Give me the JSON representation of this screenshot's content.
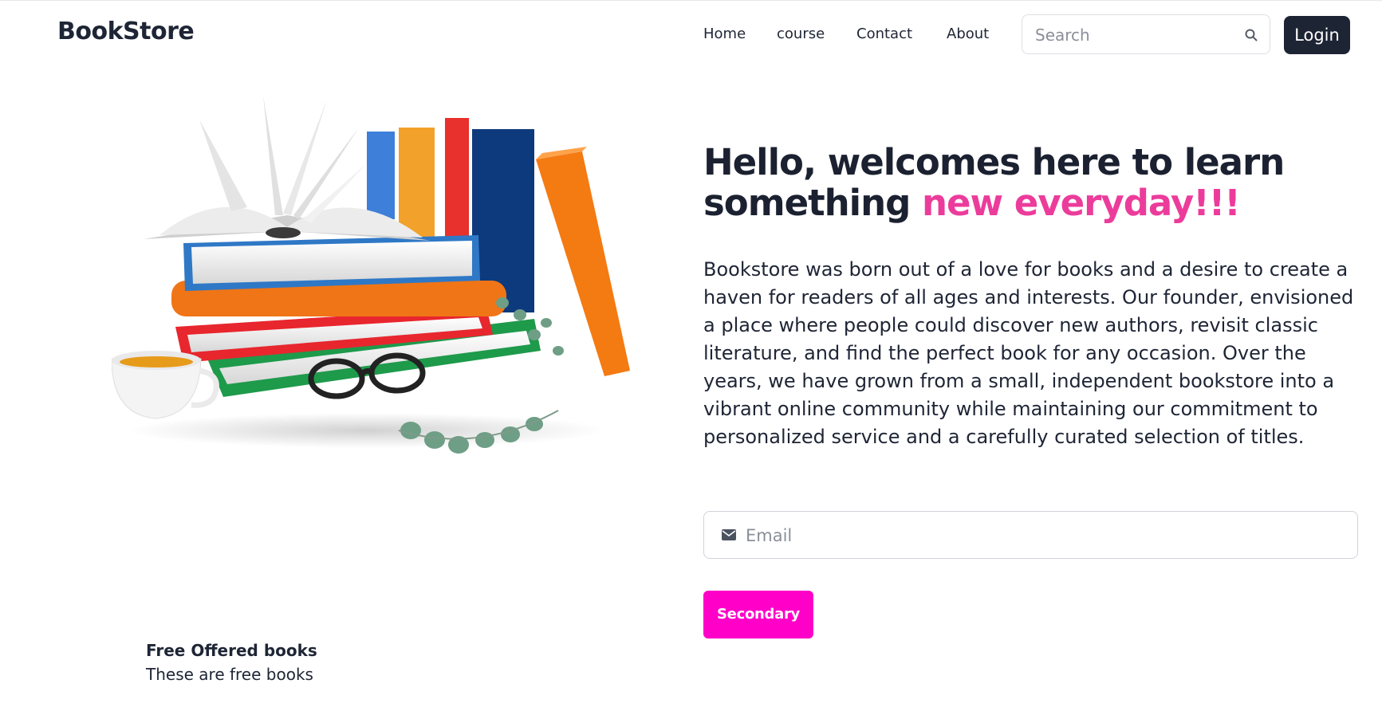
{
  "brand": {
    "name": "BookStore"
  },
  "nav": {
    "items": [
      {
        "label": "Home"
      },
      {
        "label": "course"
      },
      {
        "label": "Contact"
      },
      {
        "label": "About"
      }
    ]
  },
  "search": {
    "placeholder": "Search",
    "icon": "search-icon"
  },
  "login": {
    "label": "Login"
  },
  "hero": {
    "title_part1": "Hello, welcomes here to learn something ",
    "title_accent": "new everyday!!!",
    "accent_color": "#ec3c9b",
    "paragraph": "Bookstore was born out of a love for books and a desire to create a haven for readers of all ages and interests. Our founder, envisioned a place where people could discover new authors, revisit classic literature, and find the perfect book for any occasion. Over the years, we have grown from a small, independent bookstore into a vibrant online community while maintaining our commitment to personalized service and a carefully curated selection of titles.",
    "email_placeholder": "Email",
    "email_icon": "envelope-icon",
    "button_label": "Secondary",
    "button_color": "#ff00c8"
  },
  "offer": {
    "title": "Free Offered books",
    "subtitle": "These are free books"
  },
  "colors": {
    "dark": "#1d2433"
  }
}
